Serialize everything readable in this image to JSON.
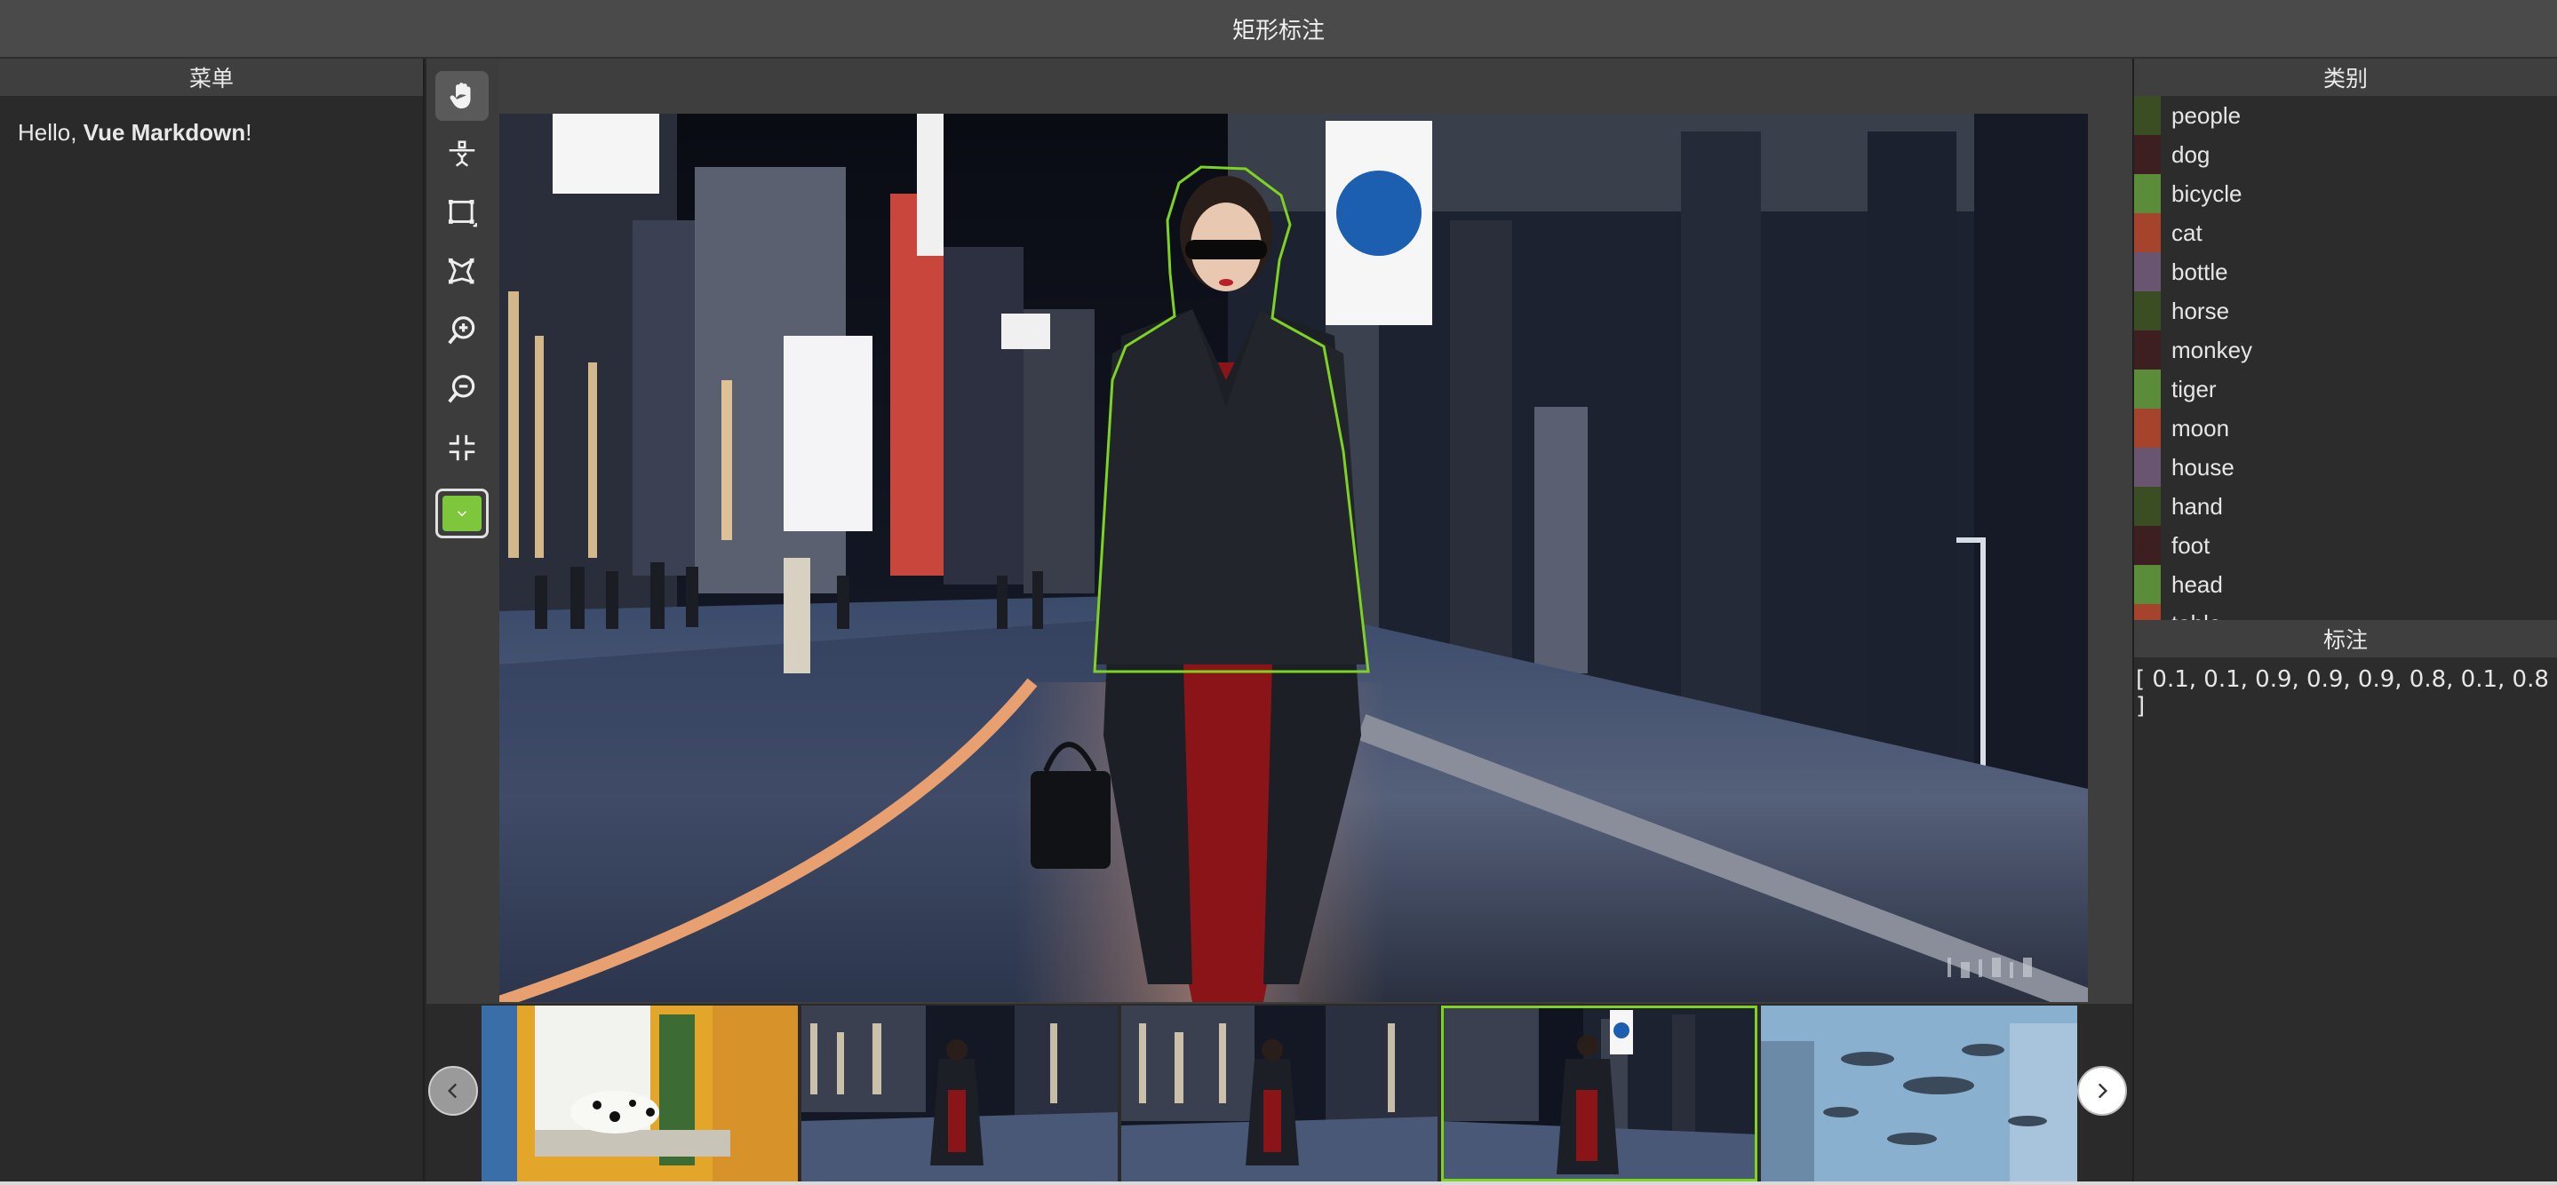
{
  "window": {
    "title": "矩形标注"
  },
  "menu": {
    "header": "菜单",
    "content_prefix": "Hello, ",
    "content_bold": "Vue Markdown",
    "content_suffix": "!"
  },
  "toolbar": {
    "tools": [
      {
        "name": "pan-tool",
        "icon": "hand-icon",
        "active": true
      },
      {
        "name": "point-tool",
        "icon": "point-select-icon",
        "active": false
      },
      {
        "name": "rect-tool",
        "icon": "rectangle-icon",
        "active": false
      },
      {
        "name": "polygon-tool",
        "icon": "polygon-icon",
        "active": false
      },
      {
        "name": "zoom-in-tool",
        "icon": "zoom-in-icon",
        "active": false
      },
      {
        "name": "zoom-out-tool",
        "icon": "zoom-out-icon",
        "active": false
      },
      {
        "name": "fit-tool",
        "icon": "fit-screen-icon",
        "active": false
      }
    ],
    "current_color": "#7ec63c"
  },
  "categories": {
    "header": "类别",
    "items": [
      {
        "label": "people",
        "color": "#3b4d22"
      },
      {
        "label": "dog",
        "color": "#3d1f22"
      },
      {
        "label": "bicycle",
        "color": "#5a8c3a"
      },
      {
        "label": "cat",
        "color": "#a5432c"
      },
      {
        "label": "bottle",
        "color": "#6a5570"
      },
      {
        "label": "horse",
        "color": "#3b4d22"
      },
      {
        "label": "monkey",
        "color": "#3d1f22"
      },
      {
        "label": "tiger",
        "color": "#5a8c3a"
      },
      {
        "label": "moon",
        "color": "#a5432c"
      },
      {
        "label": "house",
        "color": "#6a5570"
      },
      {
        "label": "hand",
        "color": "#3b4d22"
      },
      {
        "label": "foot",
        "color": "#3d1f22"
      },
      {
        "label": "head",
        "color": "#5a8c3a"
      },
      {
        "label": "table",
        "color": "#a5432c"
      }
    ]
  },
  "annotations": {
    "header": "标注",
    "value": "[ 0.1, 0.1, 0.9, 0.9, 0.9, 0.8, 0.1, 0.8 ]"
  },
  "thumbnails": {
    "items": [
      {
        "name": "thumb-dalmatian",
        "selected": false
      },
      {
        "name": "thumb-street-1",
        "selected": false
      },
      {
        "name": "thumb-street-2",
        "selected": false
      },
      {
        "name": "thumb-street-3",
        "selected": true
      },
      {
        "name": "thumb-flying-fish",
        "selected": false
      }
    ]
  },
  "annotation_color": "#7ed321"
}
